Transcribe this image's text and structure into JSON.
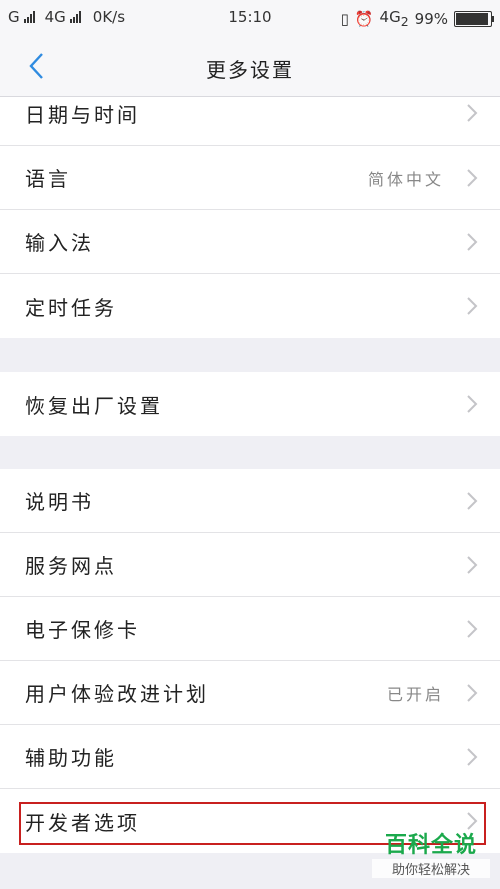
{
  "status_bar": {
    "left_carrier": "G",
    "left_network": "4G",
    "speed": "0K/s",
    "time": "15:10",
    "right_network": "4G",
    "right_network_sub": "2",
    "battery": "99%",
    "battery_level": 0.99
  },
  "header": {
    "title": "更多设置"
  },
  "group1": {
    "items": [
      {
        "label": "日期与时间",
        "value": ""
      },
      {
        "label": "语言",
        "value": "简体中文"
      },
      {
        "label": "输入法",
        "value": ""
      },
      {
        "label": "定时任务",
        "value": ""
      }
    ]
  },
  "group2": {
    "items": [
      {
        "label": "恢复出厂设置",
        "value": ""
      }
    ]
  },
  "group3": {
    "items": [
      {
        "label": "说明书",
        "value": ""
      },
      {
        "label": "服务网点",
        "value": ""
      },
      {
        "label": "电子保修卡",
        "value": ""
      },
      {
        "label": "用户体验改进计划",
        "value": "已开启"
      },
      {
        "label": "辅助功能",
        "value": ""
      },
      {
        "label": "开发者选项",
        "value": ""
      }
    ]
  },
  "watermark": {
    "title": "百科全说",
    "subtitle": "助你轻松解决"
  },
  "colors": {
    "accent": "#2f8be0",
    "highlight": "#c8201f",
    "watermark": "#1ba94c"
  }
}
